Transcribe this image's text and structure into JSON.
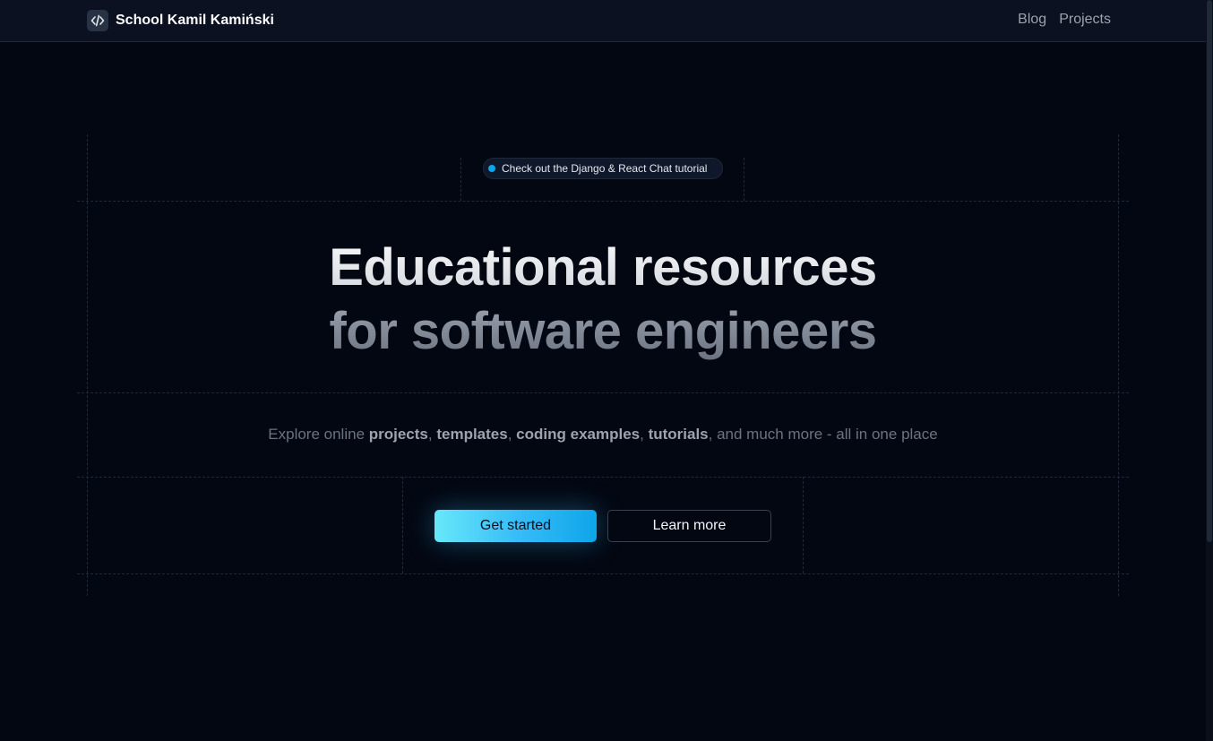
{
  "header": {
    "brand_name": "School Kamil Kamiński",
    "logo_icon": "code-icon",
    "nav": [
      {
        "label": "Blog"
      },
      {
        "label": "Projects"
      }
    ]
  },
  "hero": {
    "badge_text": "Check out the Django & React Chat tutorial",
    "title_line1": "Educational resources",
    "title_line2": "for software engineers",
    "subtitle": {
      "prefix": "Explore online ",
      "projects": "projects",
      "sep1": ", ",
      "templates": "templates",
      "sep2": ", ",
      "coding_examples": "coding examples",
      "sep3": ", ",
      "tutorials": "tutorials",
      "suffix": ", and much more - all in one place"
    },
    "primary_button": "Get started",
    "secondary_button": "Learn more"
  },
  "colors": {
    "background": "#030712",
    "accent": "#38bdf8",
    "badge_dot": "#0ea5e9"
  }
}
